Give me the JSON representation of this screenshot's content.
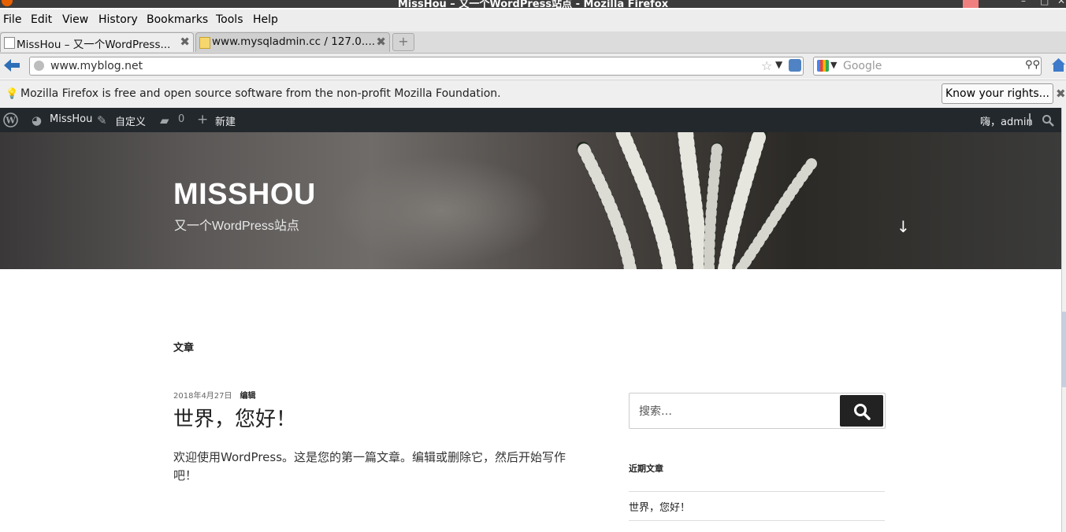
{
  "window": {
    "title": "MissHou – 又一个WordPress站点 - Mozilla Firefox"
  },
  "menu": [
    "File",
    "Edit",
    "View",
    "History",
    "Bookmarks",
    "Tools",
    "Help"
  ],
  "tabs": [
    {
      "label": "MissHou – 又一个WordPress...",
      "active": true
    },
    {
      "label": "www.mysqladmin.cc / 127.0....",
      "active": false
    }
  ],
  "nav": {
    "url": "www.myblog.net",
    "search_placeholder": "Google"
  },
  "notification": {
    "message": "Mozilla Firefox is free and open source software from the non-profit Mozilla Foundation.",
    "button": "Know your rights..."
  },
  "wp_admin_bar": {
    "site_name": "MissHou",
    "customize": "自定义",
    "comments_count": "0",
    "new": "新建",
    "greeting": "嗨，admin"
  },
  "header": {
    "site_title": "MISSHOU",
    "tagline": "又一个WordPress站点"
  },
  "main": {
    "section_label": "文章",
    "post": {
      "date": "2018年4月27日",
      "edit_label": "编辑",
      "title": "世界，您好！",
      "excerpt": "欢迎使用WordPress。这是您的第一篇文章。编辑或删除它，然后开始写作吧！"
    }
  },
  "sidebar": {
    "search_placeholder": "搜索…",
    "recent_posts_title": "近期文章",
    "recent_posts": [
      "世界，您好！"
    ]
  }
}
